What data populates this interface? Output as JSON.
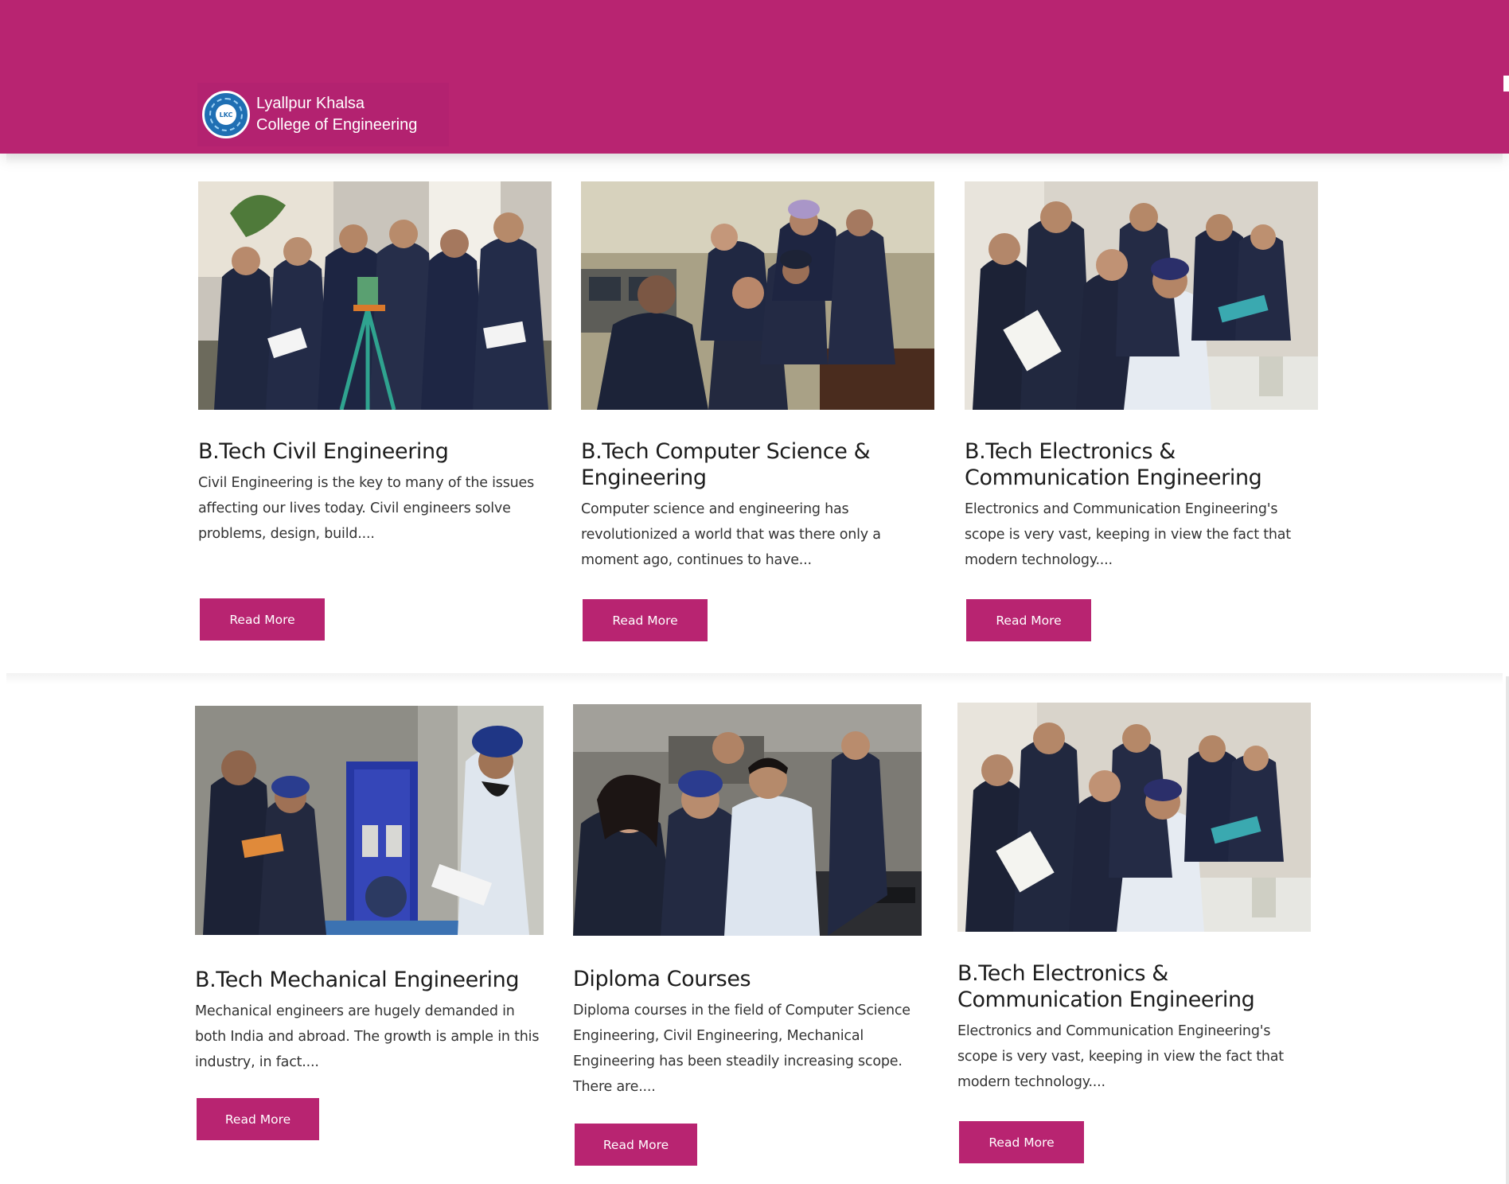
{
  "header": {
    "background": "#b82471",
    "logo": {
      "line1": "Lyallpur Khalsa",
      "line2": "College of Engineering",
      "emblem_text": "LKC",
      "icon": "college-emblem"
    }
  },
  "courses": [
    {
      "title": "B.Tech Civil Engineering",
      "description": "Civil Engineering is the key to many of the issues affecting our lives today. Civil engineers solve problems, design, build....",
      "button": "Read More",
      "photo": "students-with-surveying-instrument"
    },
    {
      "title": "B.Tech Computer Science & Engineering",
      "description": "Computer science and engineering has revolutionized a world that was there only a moment ago, continues to have...",
      "button": "Read More",
      "photo": "students-in-computer-lab"
    },
    {
      "title": "B.Tech Electronics & Communication Engineering",
      "description": "Electronics and Communication Engineering's scope is very vast, keeping in view the fact that modern technology....",
      "button": "Read More",
      "photo": "students-in-electronics-lab"
    },
    {
      "title": "B.Tech Mechanical Engineering",
      "description": "Mechanical engineers are hugely demanded in both India and abroad. The growth is ample in this industry, in fact....",
      "button": "Read More",
      "photo": "students-with-turbine-apparatus"
    },
    {
      "title": "Diploma Courses",
      "description": "Diploma courses in the field of Computer Science Engineering, Civil Engineering, Mechanical Engineering has been steadily increasing scope. There are....",
      "button": "Read More",
      "photo": "students-at-computer"
    },
    {
      "title": "B.Tech Electronics & Communication Engineering",
      "description": "Electronics and Communication Engineering's scope is very vast, keeping in view the fact that modern technology....",
      "button": "Read More",
      "photo": "students-in-electronics-lab"
    }
  ]
}
